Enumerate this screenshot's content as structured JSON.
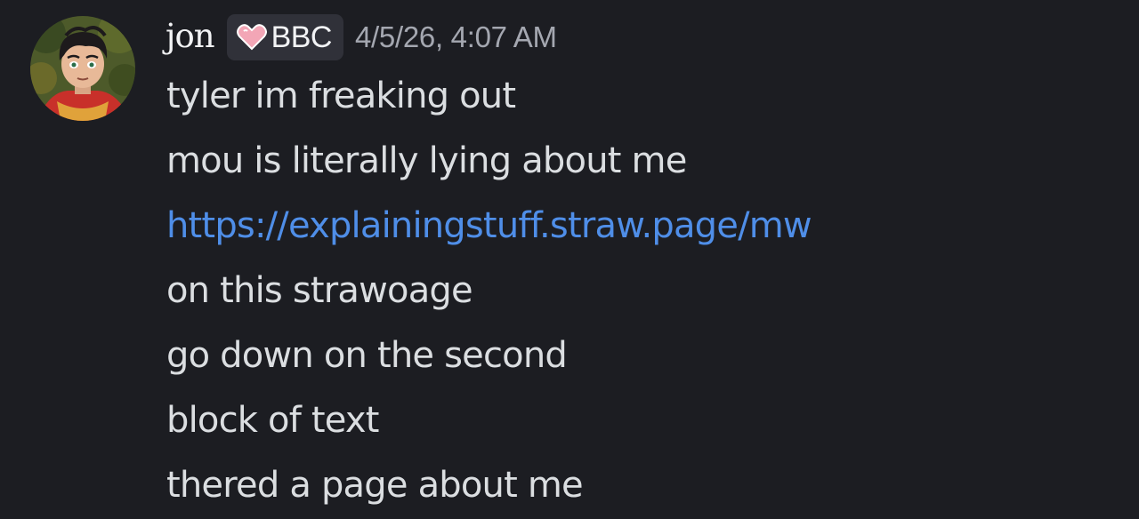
{
  "message": {
    "author": {
      "name": "jon",
      "avatar_icon": "avatar-image",
      "tag": {
        "icon": "pink-heart-icon",
        "label": "BBC"
      }
    },
    "timestamp": "4/5/26, 4:07 AM",
    "lines": [
      "tyler im freaking out",
      "mou is literally lying about me",
      "https://explainingstuff.straw.page/mw",
      "on this strawoage",
      "go down on the second",
      "block of text",
      "thered a page about me"
    ]
  },
  "colors": {
    "background": "#1c1d22",
    "username": "#f2f3f5",
    "tag_background": "#303139",
    "timestamp": "#a4a7b0",
    "message_text": "#dbdee1",
    "link": "#4f8ee8"
  }
}
